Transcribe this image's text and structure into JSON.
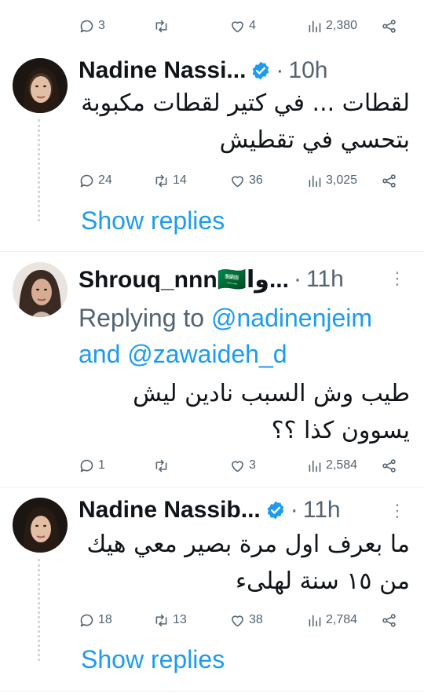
{
  "tweets": [
    {
      "stats": {
        "replies": "3",
        "retweets": "",
        "likes": "4",
        "views": "2,380"
      }
    },
    {
      "author": "Nadine Nassi...",
      "verified": true,
      "time": "10h",
      "text_line1": "لقطات ... في كتير لقطات مكبوبة",
      "text_line2": "بتحسي في تقطيش",
      "stats": {
        "replies": "24",
        "retweets": "14",
        "likes": "36",
        "views": "3,025"
      },
      "show_replies": "Show replies"
    },
    {
      "author": "Shrouq_nnn🇸🇦وا...",
      "time": "11h",
      "replying_prefix": "Replying to",
      "mention1": "@nadinenjeim",
      "and_word": "and",
      "mention2": "@zawaideh_d",
      "text_line1": "طيب وش السبب نادين ليش",
      "text_line2": "يسوون كذا ؟؟",
      "stats": {
        "replies": "1",
        "retweets": "",
        "likes": "3",
        "views": "2,584"
      }
    },
    {
      "author": "Nadine Nassib...",
      "verified": true,
      "time": "11h",
      "text_line1": "ما بعرف اول مرة بصير معي هيك",
      "text_line2": "من ١٥ سنة لهلىء",
      "stats": {
        "replies": "18",
        "retweets": "13",
        "likes": "38",
        "views": "2,784"
      },
      "show_replies": "Show replies"
    }
  ],
  "separator": "·",
  "more_glyph": "⋮",
  "colors": {
    "link": "#1d9bf0",
    "secondary": "#536471",
    "verified": "#1d9bf0"
  }
}
